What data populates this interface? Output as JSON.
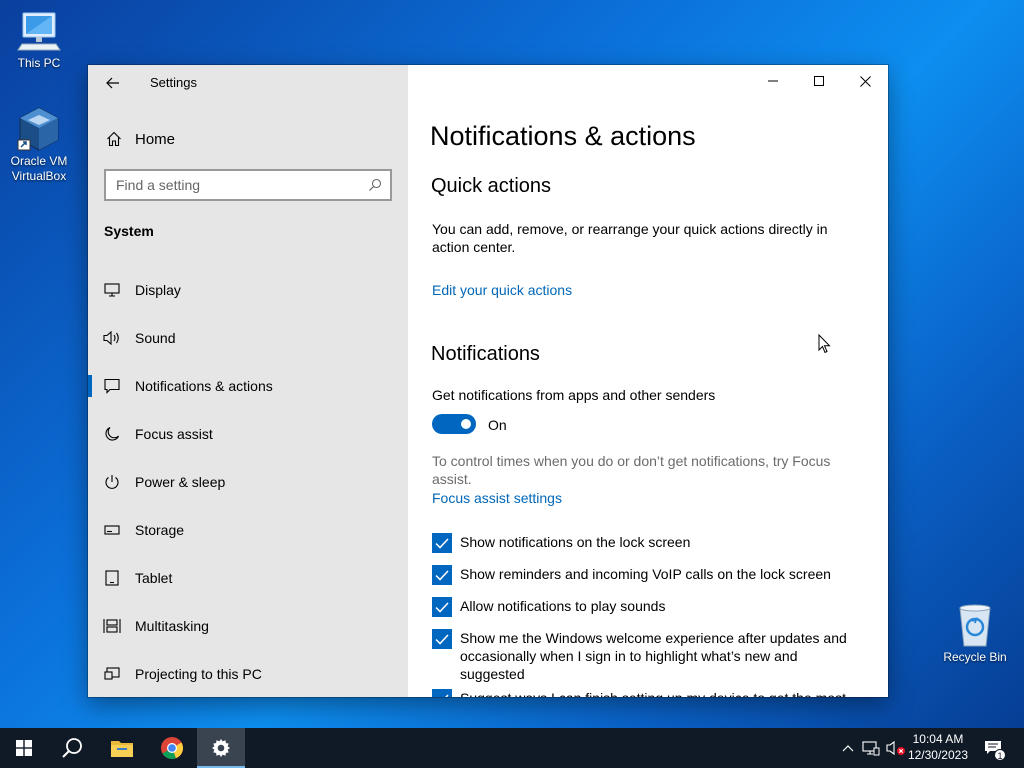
{
  "desktop": {
    "icons": [
      {
        "label": "This PC"
      },
      {
        "label": "Oracle VM VirtualBox"
      },
      {
        "label": "Recycle Bin"
      }
    ]
  },
  "window": {
    "app_title": "Settings",
    "sidebar": {
      "home_label": "Home",
      "search_placeholder": "Find a setting",
      "section_title": "System",
      "items": [
        {
          "label": "Display",
          "icon": "monitor-icon"
        },
        {
          "label": "Sound",
          "icon": "speaker-icon"
        },
        {
          "label": "Notifications & actions",
          "icon": "message-icon",
          "active": true
        },
        {
          "label": "Focus assist",
          "icon": "moon-icon"
        },
        {
          "label": "Power & sleep",
          "icon": "power-icon"
        },
        {
          "label": "Storage",
          "icon": "storage-icon"
        },
        {
          "label": "Tablet",
          "icon": "tablet-icon"
        },
        {
          "label": "Multitasking",
          "icon": "multitasking-icon"
        },
        {
          "label": "Projecting to this PC",
          "icon": "projector-icon"
        }
      ]
    },
    "content": {
      "page_title": "Notifications & actions",
      "quick_actions": {
        "heading": "Quick actions",
        "description": "You can add, remove, or rearrange your quick actions directly in action center.",
        "link": "Edit your quick actions"
      },
      "notifications": {
        "heading": "Notifications",
        "toggle_label": "Get notifications from apps and other senders",
        "toggle_state": "On",
        "toggle_on": true,
        "focus_hint": "To control times when you do or don’t get notifications, try Focus assist.",
        "focus_link": "Focus assist settings",
        "checkboxes": [
          {
            "label": "Show notifications on the lock screen",
            "checked": true
          },
          {
            "label": "Show reminders and incoming VoIP calls on the lock screen",
            "checked": true
          },
          {
            "label": "Allow notifications to play sounds",
            "checked": true
          },
          {
            "label": "Show me the Windows welcome experience after updates and occasionally when I sign in to highlight what’s new and suggested",
            "checked": true
          },
          {
            "label": "Suggest ways I can finish setting up my device to get the most out of Windows",
            "checked": true
          }
        ]
      }
    }
  },
  "taskbar": {
    "time": "10:04 AM",
    "date": "12/30/2023",
    "notification_count": "1"
  },
  "colors": {
    "accent": "#0067c0",
    "link": "#0067b8",
    "sidebar_bg": "#e6e6e6",
    "taskbar_bg": "#101a26"
  }
}
